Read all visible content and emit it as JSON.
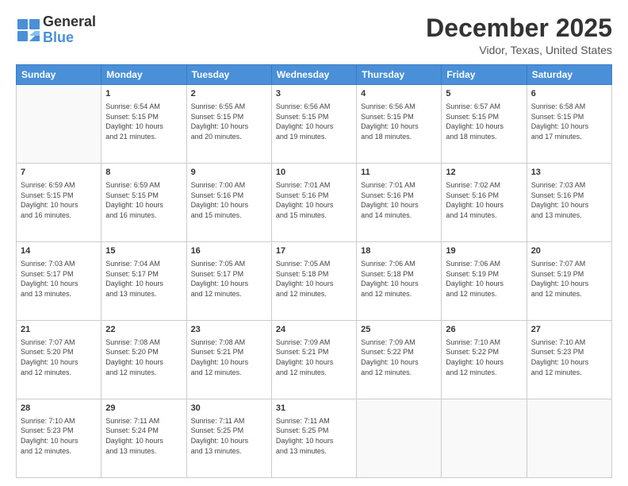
{
  "header": {
    "logo_line1": "General",
    "logo_line2": "Blue",
    "month": "December 2025",
    "location": "Vidor, Texas, United States"
  },
  "weekdays": [
    "Sunday",
    "Monday",
    "Tuesday",
    "Wednesday",
    "Thursday",
    "Friday",
    "Saturday"
  ],
  "weeks": [
    [
      {
        "day": "",
        "info": ""
      },
      {
        "day": "1",
        "info": "Sunrise: 6:54 AM\nSunset: 5:15 PM\nDaylight: 10 hours\nand 21 minutes."
      },
      {
        "day": "2",
        "info": "Sunrise: 6:55 AM\nSunset: 5:15 PM\nDaylight: 10 hours\nand 20 minutes."
      },
      {
        "day": "3",
        "info": "Sunrise: 6:56 AM\nSunset: 5:15 PM\nDaylight: 10 hours\nand 19 minutes."
      },
      {
        "day": "4",
        "info": "Sunrise: 6:56 AM\nSunset: 5:15 PM\nDaylight: 10 hours\nand 18 minutes."
      },
      {
        "day": "5",
        "info": "Sunrise: 6:57 AM\nSunset: 5:15 PM\nDaylight: 10 hours\nand 18 minutes."
      },
      {
        "day": "6",
        "info": "Sunrise: 6:58 AM\nSunset: 5:15 PM\nDaylight: 10 hours\nand 17 minutes."
      }
    ],
    [
      {
        "day": "7",
        "info": "Sunrise: 6:59 AM\nSunset: 5:15 PM\nDaylight: 10 hours\nand 16 minutes."
      },
      {
        "day": "8",
        "info": "Sunrise: 6:59 AM\nSunset: 5:15 PM\nDaylight: 10 hours\nand 16 minutes."
      },
      {
        "day": "9",
        "info": "Sunrise: 7:00 AM\nSunset: 5:16 PM\nDaylight: 10 hours\nand 15 minutes."
      },
      {
        "day": "10",
        "info": "Sunrise: 7:01 AM\nSunset: 5:16 PM\nDaylight: 10 hours\nand 15 minutes."
      },
      {
        "day": "11",
        "info": "Sunrise: 7:01 AM\nSunset: 5:16 PM\nDaylight: 10 hours\nand 14 minutes."
      },
      {
        "day": "12",
        "info": "Sunrise: 7:02 AM\nSunset: 5:16 PM\nDaylight: 10 hours\nand 14 minutes."
      },
      {
        "day": "13",
        "info": "Sunrise: 7:03 AM\nSunset: 5:16 PM\nDaylight: 10 hours\nand 13 minutes."
      }
    ],
    [
      {
        "day": "14",
        "info": "Sunrise: 7:03 AM\nSunset: 5:17 PM\nDaylight: 10 hours\nand 13 minutes."
      },
      {
        "day": "15",
        "info": "Sunrise: 7:04 AM\nSunset: 5:17 PM\nDaylight: 10 hours\nand 13 minutes."
      },
      {
        "day": "16",
        "info": "Sunrise: 7:05 AM\nSunset: 5:17 PM\nDaylight: 10 hours\nand 12 minutes."
      },
      {
        "day": "17",
        "info": "Sunrise: 7:05 AM\nSunset: 5:18 PM\nDaylight: 10 hours\nand 12 minutes."
      },
      {
        "day": "18",
        "info": "Sunrise: 7:06 AM\nSunset: 5:18 PM\nDaylight: 10 hours\nand 12 minutes."
      },
      {
        "day": "19",
        "info": "Sunrise: 7:06 AM\nSunset: 5:19 PM\nDaylight: 10 hours\nand 12 minutes."
      },
      {
        "day": "20",
        "info": "Sunrise: 7:07 AM\nSunset: 5:19 PM\nDaylight: 10 hours\nand 12 minutes."
      }
    ],
    [
      {
        "day": "21",
        "info": "Sunrise: 7:07 AM\nSunset: 5:20 PM\nDaylight: 10 hours\nand 12 minutes."
      },
      {
        "day": "22",
        "info": "Sunrise: 7:08 AM\nSunset: 5:20 PM\nDaylight: 10 hours\nand 12 minutes."
      },
      {
        "day": "23",
        "info": "Sunrise: 7:08 AM\nSunset: 5:21 PM\nDaylight: 10 hours\nand 12 minutes."
      },
      {
        "day": "24",
        "info": "Sunrise: 7:09 AM\nSunset: 5:21 PM\nDaylight: 10 hours\nand 12 minutes."
      },
      {
        "day": "25",
        "info": "Sunrise: 7:09 AM\nSunset: 5:22 PM\nDaylight: 10 hours\nand 12 minutes."
      },
      {
        "day": "26",
        "info": "Sunrise: 7:10 AM\nSunset: 5:22 PM\nDaylight: 10 hours\nand 12 minutes."
      },
      {
        "day": "27",
        "info": "Sunrise: 7:10 AM\nSunset: 5:23 PM\nDaylight: 10 hours\nand 12 minutes."
      }
    ],
    [
      {
        "day": "28",
        "info": "Sunrise: 7:10 AM\nSunset: 5:23 PM\nDaylight: 10 hours\nand 12 minutes."
      },
      {
        "day": "29",
        "info": "Sunrise: 7:11 AM\nSunset: 5:24 PM\nDaylight: 10 hours\nand 13 minutes."
      },
      {
        "day": "30",
        "info": "Sunrise: 7:11 AM\nSunset: 5:25 PM\nDaylight: 10 hours\nand 13 minutes."
      },
      {
        "day": "31",
        "info": "Sunrise: 7:11 AM\nSunset: 5:25 PM\nDaylight: 10 hours\nand 13 minutes."
      },
      {
        "day": "",
        "info": ""
      },
      {
        "day": "",
        "info": ""
      },
      {
        "day": "",
        "info": ""
      }
    ]
  ]
}
